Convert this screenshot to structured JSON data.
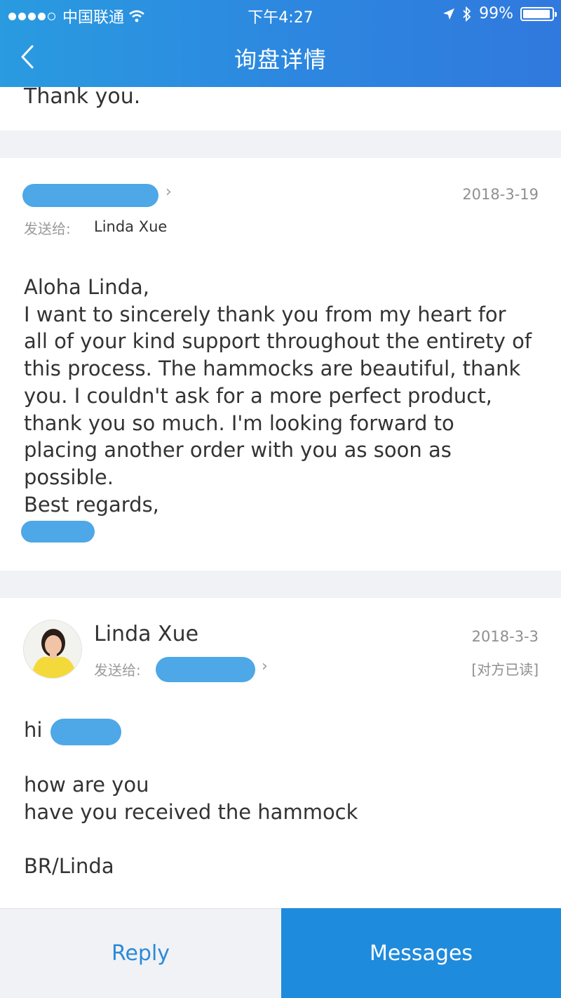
{
  "status_bar": {
    "carrier": "中国联通",
    "time": "下午4:27",
    "battery": "99%",
    "battery_level": 0.99
  },
  "nav": {
    "title": "询盘详情"
  },
  "previous_message": {
    "tail_text": "Thank you."
  },
  "message_1": {
    "date": "2018-3-19",
    "to_label": "发送给:",
    "recipient": "Linda Xue",
    "body": "Aloha Linda,\nI want to sincerely thank you from my heart for all of your kind support throughout the entirety of this process. The hammocks are beautiful, thank you. I couldn't ask for a more perfect product,  thank you so much. I'm looking forward to placing another order with you as soon as possible.\nBest regards,"
  },
  "message_2": {
    "author": "Linda Xue",
    "date": "2018-3-3",
    "to_label": "发送给:",
    "read_status": "[对方已读]",
    "greeting": "hi",
    "body": "how are you\nhave you received the hammock\n\nBR/Linda"
  },
  "bottom_bar": {
    "reply_label": "Reply",
    "messages_label": "Messages"
  },
  "colors": {
    "header": "#2d86df",
    "accent": "#1f8bdc",
    "redaction": "#4ea7e6"
  }
}
